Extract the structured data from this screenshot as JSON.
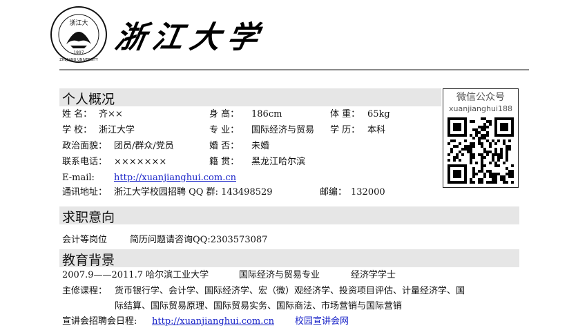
{
  "header": {
    "university_name": "浙江大学",
    "logo_text_top": "浙江大",
    "logo_text_ring": "ZHEJIANG UNIVERSITY",
    "logo_year": "1897"
  },
  "sections": {
    "profile_title": "个人概况",
    "intent_title": "求职意向",
    "education_title": "教育背景"
  },
  "profile": {
    "name_label": "姓  名：",
    "name_value": "齐××",
    "height_label": "身  高：",
    "height_value": "186cm",
    "weight_label": "体  重：",
    "weight_value": "65kg",
    "school_label": "学  校：",
    "school_value": "浙江大学",
    "major_label": "专  业：",
    "major_value": "国际经济与贸易",
    "degree_label": "学  历：",
    "degree_value": "本科",
    "politics_label": "政治面貌：",
    "politics_value": "团员/群众/党员",
    "marital_label": "婚  否：",
    "marital_value": "未婚",
    "phone_label": "联系电话：",
    "phone_value": "×××××××",
    "native_label": "籍  贯：",
    "native_value": "黑龙江哈尔滨",
    "email_label": "E-mail:",
    "email_value": "http://xuanjianghui.com.cn",
    "address_label": "通讯地址：",
    "address_value": "浙江大学校园招聘 QQ 群: 143498529",
    "postcode_label": "邮编：",
    "postcode_value": "132000"
  },
  "qr": {
    "title": "微信公众号",
    "account": "xuanjianghui188"
  },
  "intent": {
    "position": "会计等岗位",
    "consult": "简历问题请咨询QQ:2303573087"
  },
  "education": {
    "period": "2007.9——2011.7 哈尔滨工业大学",
    "major": "国际经济与贸易专业",
    "degree": "经济学学士",
    "courses_label": "主修课程：",
    "courses_line1": "货币银行学、会计学、国际经济学、宏（微）观经济学、投资项目评估、计量经济学、国",
    "courses_line2": "际结算、国际贸易原理、国际贸易实务、国际商法、市场营销与国际营销",
    "recruit_label": "宣讲会招聘会日程:",
    "recruit_link": "http://xuanjianghui.com.cn",
    "recruit_site": "校园宣讲会网"
  }
}
